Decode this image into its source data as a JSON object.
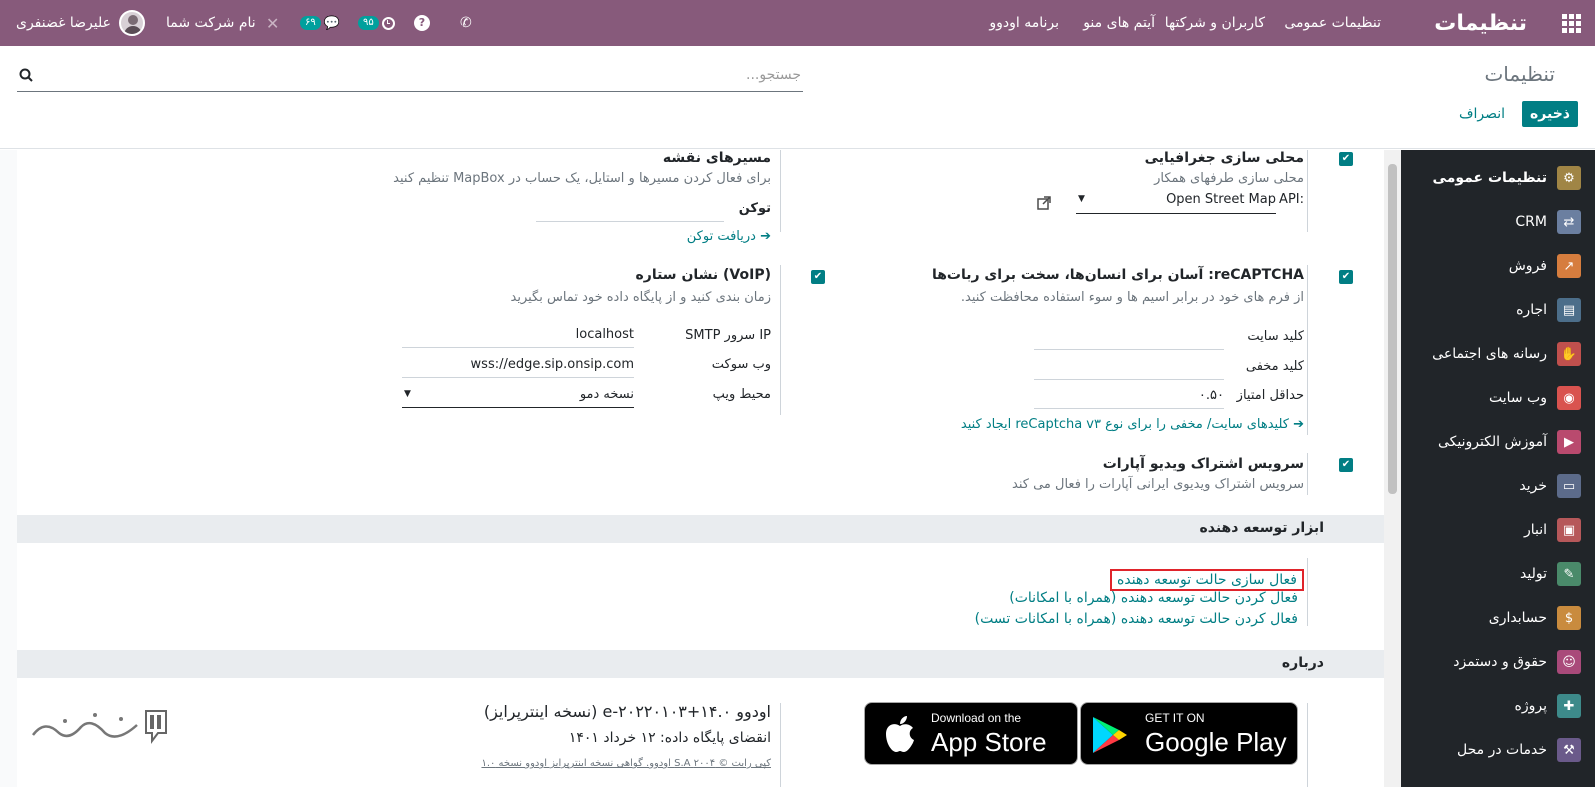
{
  "topbar": {
    "app_title": "تنظیمات",
    "menu": [
      "تنظیمات عمومی",
      "کاربران و شرکتها",
      "آیتم های منو",
      "برنامه اودوو"
    ],
    "user_name": "علیرضا غضنفری",
    "company": "نام شرکت شما",
    "chat_count": "۶۹",
    "activity_count": "۹۵"
  },
  "control_panel": {
    "breadcrumb": "تنظیمات",
    "search_placeholder": "جستجو...",
    "save_label": "ذخیره",
    "discard_label": "انصراف"
  },
  "sidebar": {
    "items": [
      {
        "label": "تنظیمات عمومی",
        "icon": "gear-icon",
        "color": "#a08545",
        "glyph": "⚙"
      },
      {
        "label": "CRM",
        "icon": "handshake-icon",
        "color": "#6b7fa0",
        "glyph": "⇄"
      },
      {
        "label": "فروش",
        "icon": "chart-icon",
        "color": "#d67d3e",
        "glyph": "↗"
      },
      {
        "label": "اجاره",
        "icon": "rental-icon",
        "color": "#4c6e8a",
        "glyph": "▤"
      },
      {
        "label": "رسانه های اجتماعی",
        "icon": "thumbs-up-icon",
        "color": "#c0504d",
        "glyph": "👍"
      },
      {
        "label": "وب سایت",
        "icon": "globe-icon",
        "color": "#d9534f",
        "glyph": "◉"
      },
      {
        "label": "آموزش الکترونیکی",
        "icon": "elearning-icon",
        "color": "#b94a6e",
        "glyph": "▶"
      },
      {
        "label": "خرید",
        "icon": "credit-card-icon",
        "color": "#5c6b8a",
        "glyph": "▭"
      },
      {
        "label": "انبار",
        "icon": "box-icon",
        "color": "#b6585a",
        "glyph": "▣"
      },
      {
        "label": "تولید",
        "icon": "wrench-icon",
        "color": "#4a8a6a",
        "glyph": "✎"
      },
      {
        "label": "حسابداری",
        "icon": "invoice-icon",
        "color": "#c98b3e",
        "glyph": "$"
      },
      {
        "label": "حقوق و دستمزد",
        "icon": "payroll-icon",
        "color": "#a94a7a",
        "glyph": "☺"
      },
      {
        "label": "پروژه",
        "icon": "puzzle-icon",
        "color": "#3d8a8a",
        "glyph": "✚"
      },
      {
        "label": "خدمات در محل",
        "icon": "field-service-icon",
        "color": "#6a5a8a",
        "glyph": "⚒"
      }
    ]
  },
  "settings": {
    "geo": {
      "title": "محلی سازی جغرافیایی",
      "desc": "محلی سازی طرفهای همکار",
      "api_label": "API:",
      "api_value": "Open Street Map"
    },
    "map_routes": {
      "title": "مسیرهای نقشه",
      "desc": "برای فعال کردن مسیرها و استایل، یک حساب در MapBox تنظیم کنید",
      "token_label": "توکن",
      "token_link": "دریافت توکن"
    },
    "recaptcha": {
      "title": "reCAPTCHA: آسان برای انسان‌ها، سخت برای ربات‌ها",
      "desc": "از فرم های خود در برابر اسیم ها و سوء استفاده محافظت کنید.",
      "site_key_label": "کلید سایت",
      "secret_key_label": "کلید مخفی",
      "min_score_label": "حداقل امتیاز",
      "min_score_value": "۰.۵۰",
      "link": "کلیدهای سایت/ مخفی را برای نوع reCaptcha v۳ ایجاد کنید"
    },
    "voip": {
      "title": "(VoIP) نشان ستاره",
      "desc": "زمان بندی کنید و از پایگاه داده خود تماس بگیرید",
      "smtp_label": "IP سرور SMTP",
      "smtp_value": "localhost",
      "socket_label": "وب سوکت",
      "socket_value": "wss://edge.sip.onsip.com",
      "env_label": "محیط ویپ",
      "env_value": "نسخه دمو"
    },
    "aparat": {
      "title": "سرویس اشتراک ویدیو آپارات",
      "desc": "سرویس اشتراک ویدیوی ایرانی آپارات را فعال می کند"
    }
  },
  "developer": {
    "section_title": "ابزار توسعه دهنده",
    "links": [
      "فعال سازی حالت توسعه دهنده",
      "فعال کردن حالت توسعه دهنده (همراه با امکانات)",
      "فعال کردن حالت توسعه دهنده (همراه با امکانات تست)"
    ]
  },
  "about": {
    "section_title": "درباره",
    "version": "اودوو e-۲۰۲۲۰۱۰۳+۱۴.۰ (نسخه اینترپرایز)",
    "expiry": "انقضای پایگاه داده: ۱۲ خرداد ۱۴۰۱",
    "copyright": "کپی رایت © ۲۰۰۴ S.A اودوو. گواهی نسخه اینترپرایز اودوو نسخه ۱.۰",
    "appstore_small": "Download on the",
    "appstore_big": "App Store",
    "play_small": "GET IT ON",
    "play_big": "Google Play",
    "watermark": "تسهیل گستر"
  },
  "colors": {
    "brand": "#875a7b",
    "accent": "#017e84",
    "highlight": "#e0242b"
  }
}
